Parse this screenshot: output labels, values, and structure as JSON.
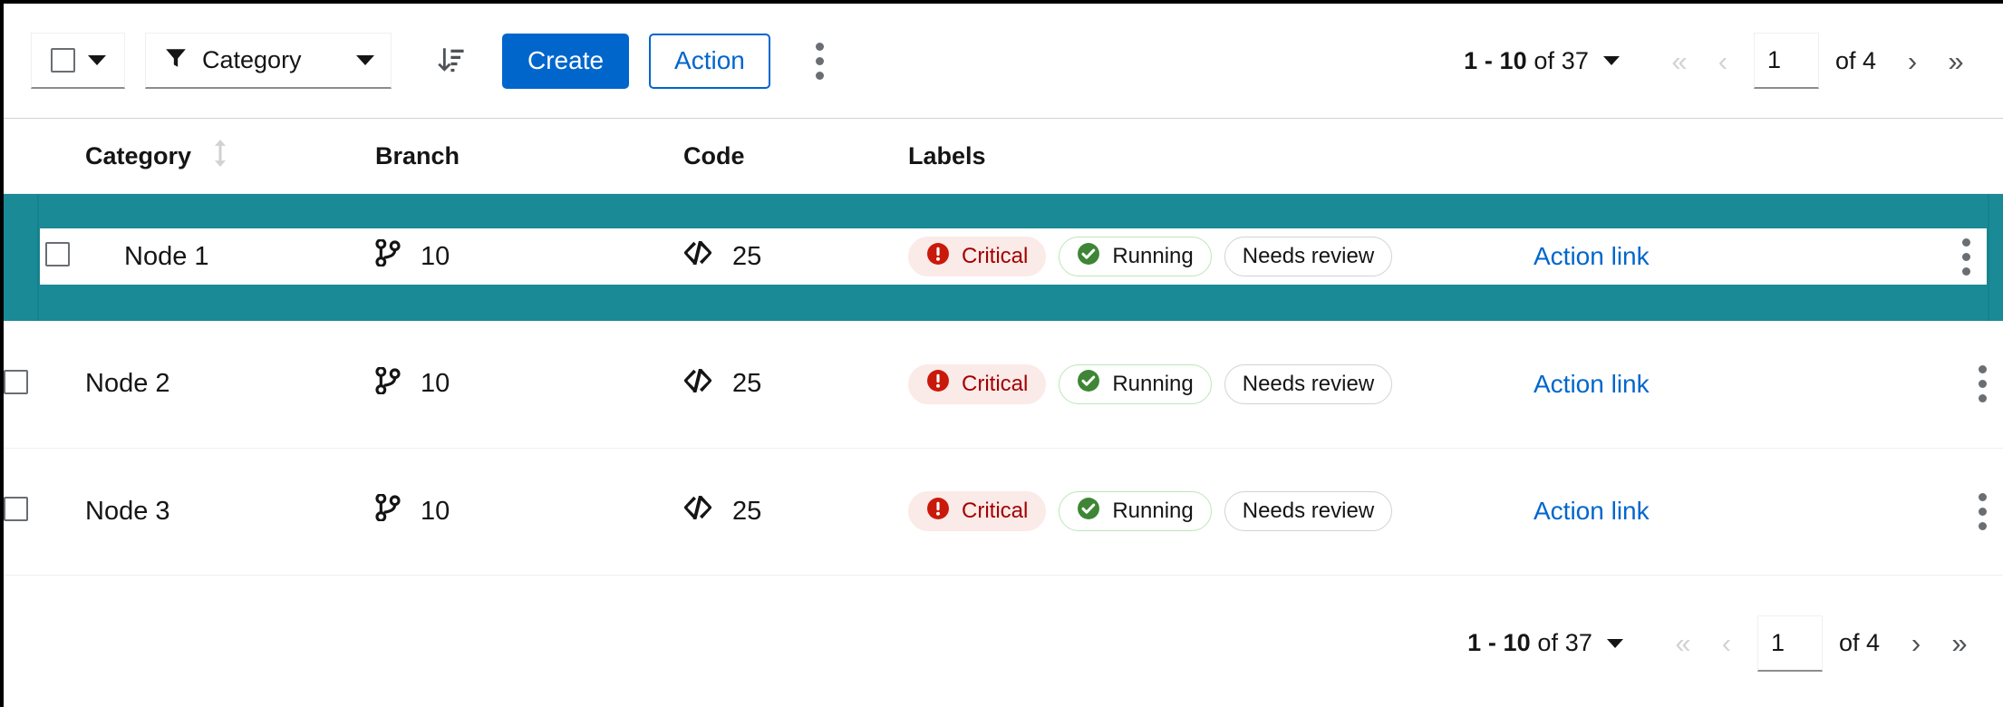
{
  "toolbar": {
    "bulk_select": {
      "icon": "checkbox-icon",
      "caret": "chevron-down-icon"
    },
    "filter": {
      "icon": "filter-funnel-icon",
      "label": "Category",
      "caret": "chevron-down-icon"
    },
    "sort_icon": "sort-amount-down-icon",
    "create_label": "Create",
    "action_label": "Action",
    "overflow_icon": "kebab-vertical-icon"
  },
  "pagination": {
    "range_start": "1",
    "range_dash": "-",
    "range_end": "10",
    "of_word": "of",
    "total": "37",
    "summary_prefix": "1 - 10",
    "summary_suffix": "of 37",
    "first_icon": "angle-double-left-icon",
    "prev_icon": "angle-left-icon",
    "page_value": "1",
    "page_total_label": "of 4",
    "next_icon": "angle-right-icon",
    "last_icon": "angle-double-right-icon",
    "options_caret": "chevron-down-icon"
  },
  "table": {
    "columns": [
      {
        "key": "category",
        "label": "Category",
        "sortable": true,
        "sort_icon": "sort-arrows-icon"
      },
      {
        "key": "branch",
        "label": "Branch",
        "sortable": false
      },
      {
        "key": "code",
        "label": "Code",
        "sortable": false
      },
      {
        "key": "labels",
        "label": "Labels",
        "sortable": false
      }
    ],
    "rows": [
      {
        "selected": true,
        "category": "Node 1",
        "branch": {
          "icon": "code-branch-icon",
          "value": "10"
        },
        "code": {
          "icon": "code-icon",
          "value": "25"
        },
        "labels": [
          {
            "text": "Critical",
            "style": "red",
            "icon": "exclamation-circle-icon"
          },
          {
            "text": "Running",
            "style": "green",
            "icon": "check-circle-icon"
          },
          {
            "text": "Needs review",
            "style": "grey",
            "icon": ""
          }
        ],
        "action": "Action link",
        "overflow_icon": "kebab-vertical-icon"
      },
      {
        "selected": false,
        "category": "Node 2",
        "branch": {
          "icon": "code-branch-icon",
          "value": "10"
        },
        "code": {
          "icon": "code-icon",
          "value": "25"
        },
        "labels": [
          {
            "text": "Critical",
            "style": "red",
            "icon": "exclamation-circle-icon"
          },
          {
            "text": "Running",
            "style": "green",
            "icon": "check-circle-icon"
          },
          {
            "text": "Needs review",
            "style": "grey",
            "icon": ""
          }
        ],
        "action": "Action link",
        "overflow_icon": "kebab-vertical-icon"
      },
      {
        "selected": false,
        "category": "Node 3",
        "branch": {
          "icon": "code-branch-icon",
          "value": "10"
        },
        "code": {
          "icon": "code-icon",
          "value": "25"
        },
        "labels": [
          {
            "text": "Critical",
            "style": "red",
            "icon": "exclamation-circle-icon"
          },
          {
            "text": "Running",
            "style": "green",
            "icon": "check-circle-icon"
          },
          {
            "text": "Needs review",
            "style": "grey",
            "icon": ""
          }
        ],
        "action": "Action link",
        "overflow_icon": "kebab-vertical-icon"
      }
    ]
  },
  "colors": {
    "primary_blue": "#0066cc",
    "link_blue": "#0066cc",
    "selected_teal": "#1a8a96",
    "danger_red": "#a30000",
    "danger_bg": "#faeae8",
    "success_green": "#3e8635",
    "border_grey": "#d2d2d2"
  }
}
